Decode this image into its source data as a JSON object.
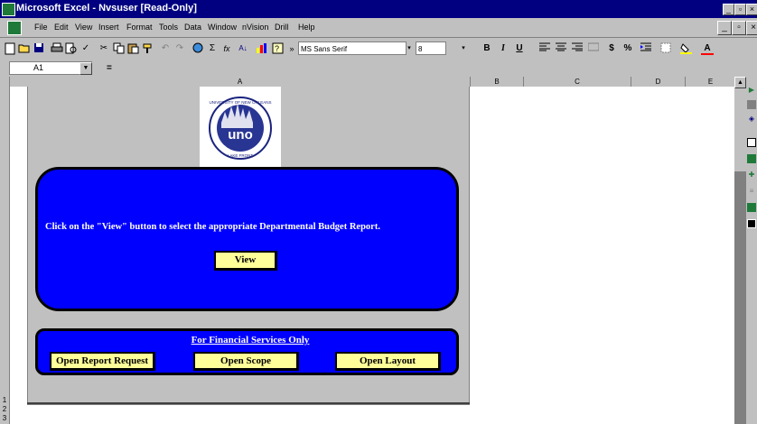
{
  "window": {
    "title": "Microsoft Excel - Nvsuser [Read-Only]",
    "controls": [
      "_",
      "▫",
      "×"
    ]
  },
  "menubar": {
    "items": [
      "File",
      "Edit",
      "View",
      "Insert",
      "Format",
      "Tools",
      "Data",
      "Window",
      "nVision",
      "Drill",
      "Help"
    ],
    "mdi_controls": [
      "_",
      "▫",
      "×"
    ]
  },
  "toolbar": {
    "font_name": "MS Sans Serif",
    "font_size": "8",
    "bold": "B",
    "italic": "I",
    "underline": "U",
    "currency": "$",
    "percent": "%",
    "autosum": "Σ",
    "function": "fx",
    "overflow": "»"
  },
  "formula_bar": {
    "cell_ref": "A1",
    "equals": "=",
    "content": ""
  },
  "columns": [
    "A",
    "B",
    "C",
    "D",
    "E"
  ],
  "rows": [
    "1",
    "2",
    "3"
  ],
  "logo": {
    "ring_text": "UNIVERSITY OF NEW ORLEANS",
    "center_text": "uno",
    "bottom_text": "LAKE FRONT"
  },
  "main_panel": {
    "message": "Click on the \"View\" button to select the appropriate Departmental Budget Report.",
    "view_button": "View"
  },
  "fs_panel": {
    "title": "For Financial Services Only",
    "buttons": [
      "Open Report Request",
      "Open Scope",
      "Open Layout"
    ]
  },
  "colors": {
    "title_bar": "#000080",
    "panel_blue": "#0000ff",
    "button_yellow": "#ffff99",
    "chrome": "#c0c0c0"
  }
}
